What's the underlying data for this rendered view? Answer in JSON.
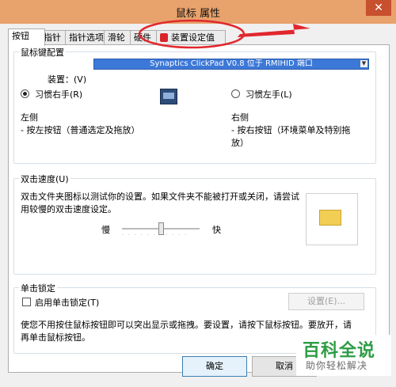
{
  "window": {
    "title": "鼠标 属性",
    "close_glyph": "✕"
  },
  "tabs": [
    "按钮",
    "指针",
    "指针选项",
    "滑轮",
    "硬件",
    "装置设定值"
  ],
  "buttons_group": {
    "title": "鼠标键配置",
    "device_label": "装置：(V)",
    "device_value": "Synaptics ClickPad V0.8 位于 RMIHID 端口",
    "right_hand_label": "习惯右手(R)",
    "left_hand_label": "习惯左手(L)",
    "right_hand_selected": true,
    "left_title": "左侧",
    "left_desc": "- 按左按钮（普通选定及拖放）",
    "right_title": "右侧",
    "right_desc_1": "- 按右按钮（环境菜单及特别拖",
    "right_desc_2": "放）"
  },
  "double_click": {
    "title": "双击速度(U)",
    "desc_1": "双击文件夹图标以测试你的设置。如果文件夹不能被打开或关闭，请尝试",
    "desc_2": "用较慢的双击速度设定。",
    "slow_label": "慢",
    "fast_label": "快",
    "slider_value": 0.5
  },
  "click_lock": {
    "title": "单击锁定",
    "checkbox_label": "启用单击锁定(T)",
    "checked": false,
    "settings_label": "设置(E)...",
    "desc_1": "使您不用按住鼠标按钮即可以突出显示或拖拽。要设置，请按下鼠标按钮。要放开，请",
    "desc_2": "再单击鼠标按钮。"
  },
  "footer": {
    "ok_label": "确定",
    "cancel_label": "取消"
  },
  "watermark": {
    "line1": "百科全说",
    "line2": "助你轻松解决"
  },
  "colors": {
    "titlebar": "#E8A26B",
    "close": "#C7502F",
    "annotation": "#E0282E",
    "select": "#3C78D8",
    "watermark": "#2E9C45"
  }
}
